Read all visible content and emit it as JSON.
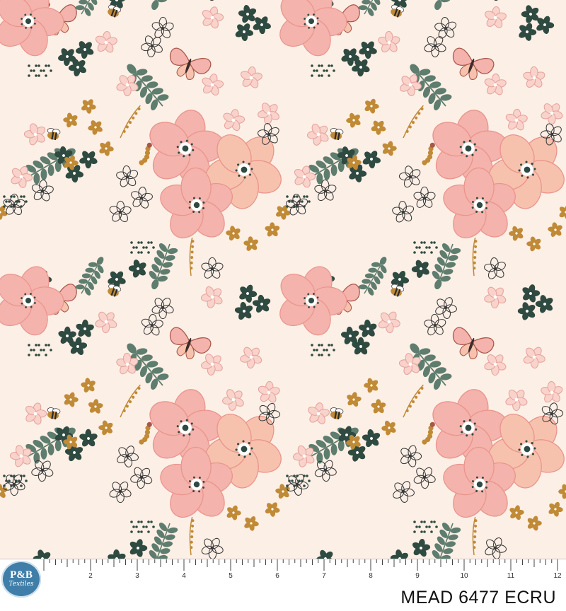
{
  "brand": {
    "logo_line1": "P&B",
    "logo_line2": "Textiles"
  },
  "ruler": {
    "unit": "inch",
    "numbers": [
      "2",
      "3",
      "4",
      "5",
      "6",
      "7",
      "8",
      "9",
      "10",
      "11",
      "12"
    ]
  },
  "swatch": {
    "label": "MEAD 6477 ECRU"
  },
  "colors": {
    "background": "#fcefe6",
    "blush": "#f4b3ac",
    "peach": "#f7c2ad",
    "sage": "#5e7d6e",
    "forest": "#2f4a40",
    "mustard": "#c08a36",
    "rust": "#a8584a",
    "ink": "#3a3a3a"
  }
}
